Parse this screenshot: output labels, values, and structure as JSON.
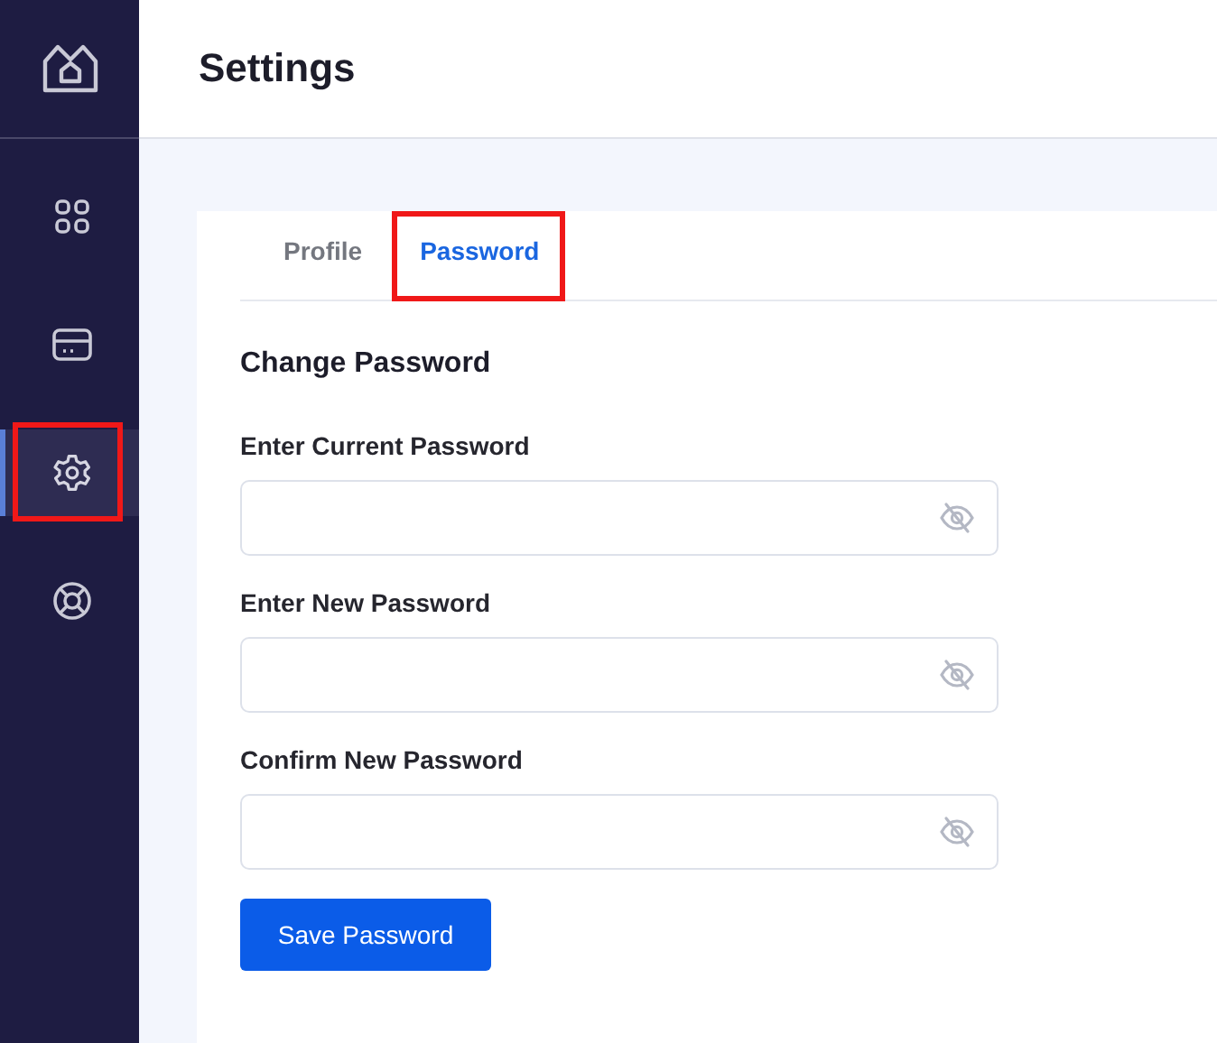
{
  "sidebar": {
    "items": [
      {
        "selected": false,
        "highlighted": false
      },
      {
        "selected": false,
        "highlighted": false
      },
      {
        "selected": true,
        "highlighted": true
      },
      {
        "selected": false,
        "highlighted": false
      }
    ]
  },
  "header": {
    "title": "Settings"
  },
  "tabs": [
    {
      "label": "Profile",
      "selected": false,
      "highlighted": false
    },
    {
      "label": "Password",
      "selected": true,
      "highlighted": true
    }
  ],
  "form": {
    "heading": "Change Password",
    "fields": [
      {
        "label": "Enter Current Password"
      },
      {
        "label": "Enter New Password"
      },
      {
        "label": "Confirm New Password"
      }
    ],
    "button": "Save Password"
  }
}
